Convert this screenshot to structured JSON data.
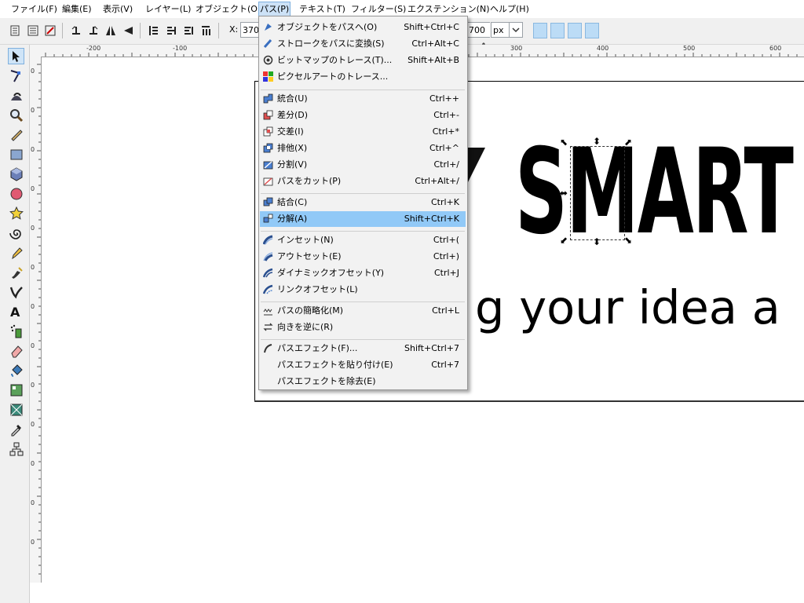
{
  "menubar": {
    "items": [
      {
        "label": "ファイル(F)"
      },
      {
        "label": "編集(E)"
      },
      {
        "label": "表示(V)"
      },
      {
        "label": "レイヤー(L)"
      },
      {
        "label": "オブジェクト(O)"
      },
      {
        "label": "パス(P)",
        "active": true
      },
      {
        "label": "テキスト(T)"
      },
      {
        "label": "フィルター(S)"
      },
      {
        "label": "エクステンション(N)"
      },
      {
        "label": "ヘルプ(H)"
      }
    ]
  },
  "toolbar": {
    "x_label": "X:",
    "x_value": "370",
    "h_value": "700",
    "unit": "px"
  },
  "path_menu": {
    "items": [
      {
        "label": "オブジェクトをパスへ(O)",
        "shortcut": "Shift+Ctrl+C"
      },
      {
        "label": "ストロークをパスに変換(S)",
        "shortcut": "Ctrl+Alt+C"
      },
      {
        "label": "ビットマップのトレース(T)...",
        "shortcut": "Shift+Alt+B"
      },
      {
        "label": "ピクセルアートのトレース...",
        "shortcut": ""
      },
      {
        "label": "統合(U)",
        "shortcut": "Ctrl++"
      },
      {
        "label": "差分(D)",
        "shortcut": "Ctrl+-"
      },
      {
        "label": "交差(I)",
        "shortcut": "Ctrl+*"
      },
      {
        "label": "排他(X)",
        "shortcut": "Ctrl+^"
      },
      {
        "label": "分割(V)",
        "shortcut": "Ctrl+/"
      },
      {
        "label": "パスをカット(P)",
        "shortcut": "Ctrl+Alt+/"
      },
      {
        "label": "結合(C)",
        "shortcut": "Ctrl+K"
      },
      {
        "label": "分解(A)",
        "shortcut": "Shift+Ctrl+K",
        "highlighted": true
      },
      {
        "label": "インセット(N)",
        "shortcut": "Ctrl+("
      },
      {
        "label": "アウトセット(E)",
        "shortcut": "Ctrl+)"
      },
      {
        "label": "ダイナミックオフセット(Y)",
        "shortcut": "Ctrl+J"
      },
      {
        "label": "リンクオフセット(L)",
        "shortcut": ""
      },
      {
        "label": "パスの簡略化(M)",
        "shortcut": "Ctrl+L"
      },
      {
        "label": "向きを逆に(R)",
        "shortcut": ""
      },
      {
        "label": "パスエフェクト(F)...",
        "shortcut": "Shift+Ctrl+7"
      },
      {
        "label": "パスエフェクトを貼り付け(E)",
        "shortcut": "Ctrl+7"
      },
      {
        "label": "パスエフェクトを除去(E)",
        "shortcut": ""
      }
    ]
  },
  "ruler": {
    "top_labels": [
      "-200",
      "-100",
      "100",
      "300",
      "400",
      "500",
      "600"
    ],
    "left_labels": [
      "0",
      "0",
      "0",
      "0",
      "0",
      "0",
      "0",
      "0",
      "0",
      "0",
      "0",
      "0",
      "0"
    ]
  },
  "canvas": {
    "logo_text": "SMART",
    "tagline": "g your idea a"
  },
  "colors": {
    "menu_highlight": "#91c9f7",
    "active_menubar": "#cde2f7",
    "snap_button": "#bcdcf6"
  }
}
